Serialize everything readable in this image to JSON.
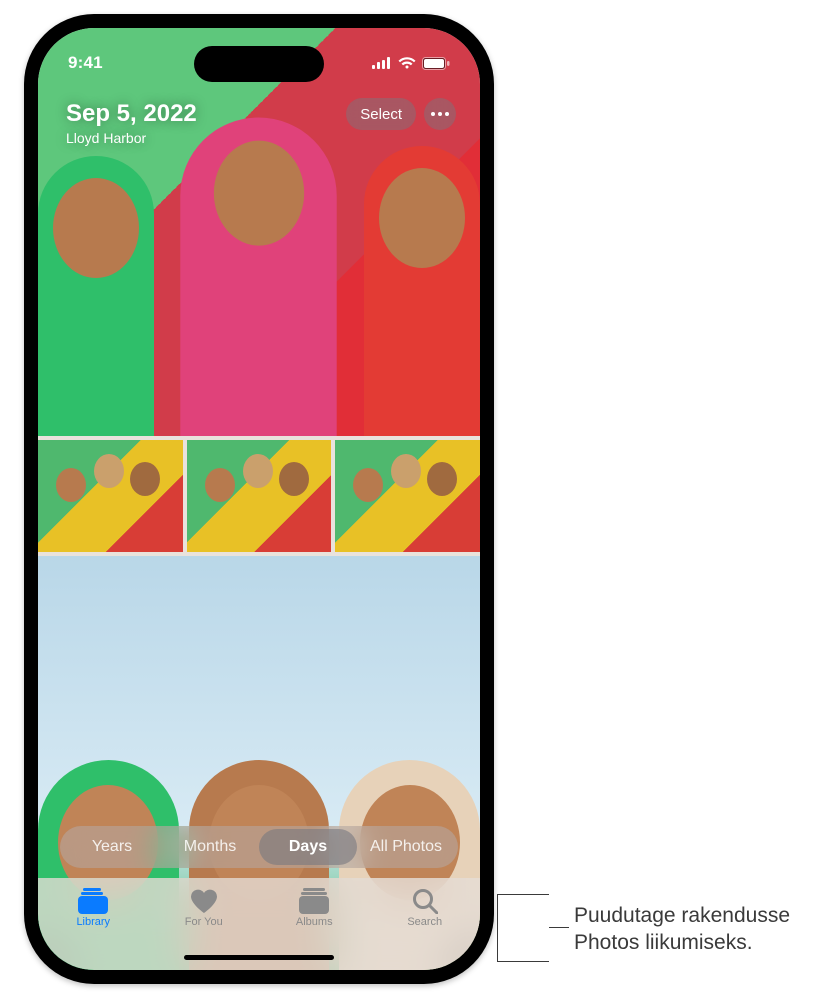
{
  "statusbar": {
    "time": "9:41"
  },
  "heading": {
    "date": "Sep 5, 2022",
    "location": "Lloyd Harbor"
  },
  "top_actions": {
    "select_label": "Select"
  },
  "view_switcher": {
    "items": [
      "Years",
      "Months",
      "Days",
      "All Photos"
    ],
    "active_index": 2
  },
  "tabbar": {
    "items": [
      {
        "id": "library",
        "label": "Library"
      },
      {
        "id": "for-you",
        "label": "For You"
      },
      {
        "id": "albums",
        "label": "Albums"
      },
      {
        "id": "search",
        "label": "Search"
      }
    ],
    "active_index": 0
  },
  "callout": {
    "line1": "Puudutage rakendusse",
    "line2": "Photos liikumiseks."
  },
  "colors": {
    "accent": "#0a7bff"
  }
}
